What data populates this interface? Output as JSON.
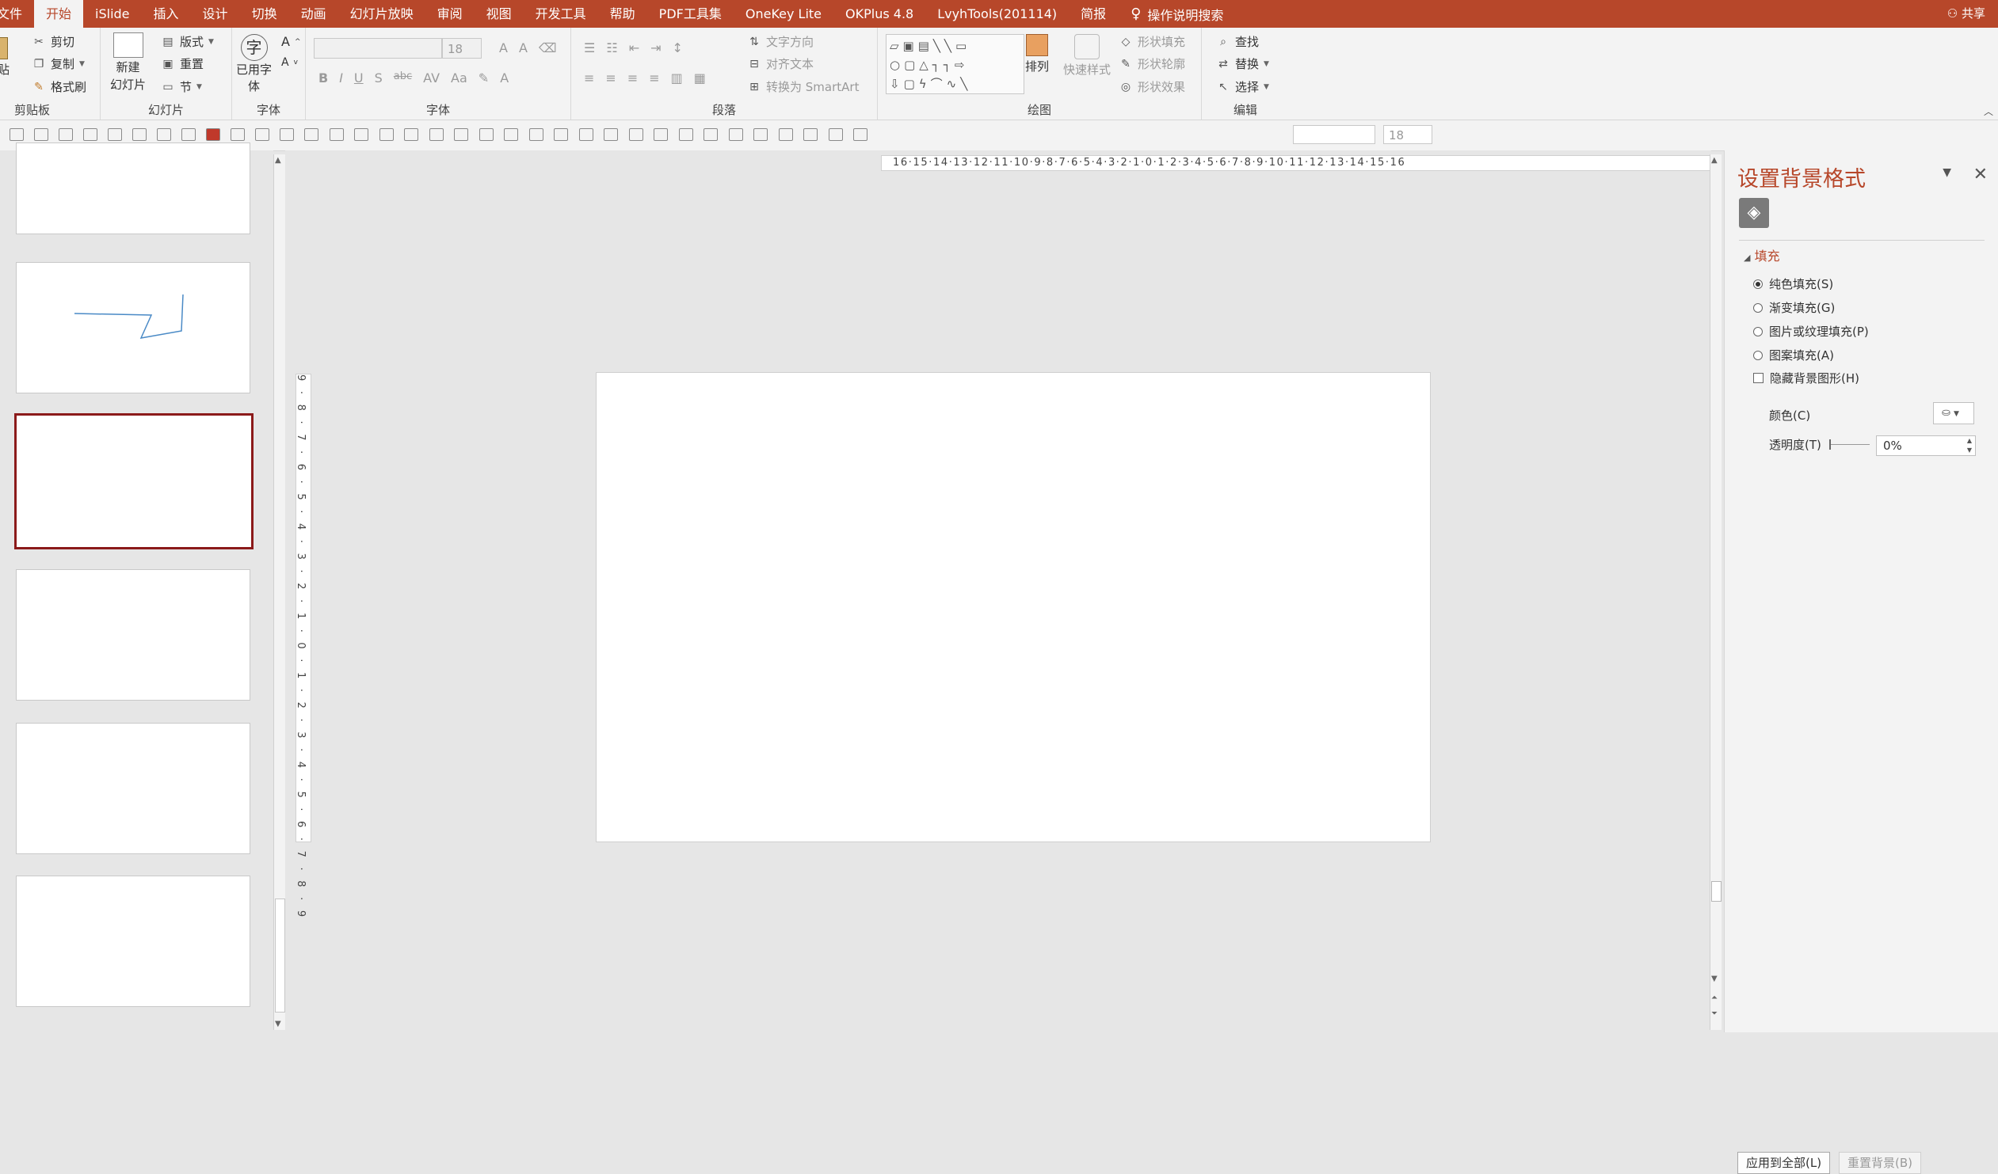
{
  "tabs": [
    "文件",
    "开始",
    "iSlide",
    "插入",
    "设计",
    "切换",
    "动画",
    "幻灯片放映",
    "审阅",
    "视图",
    "开发工具",
    "帮助",
    "PDF工具集",
    "OneKey Lite",
    "OKPlus 4.8",
    "LvyhTools(201114)",
    "简报"
  ],
  "tell_me": "操作说明搜索",
  "share": "共享",
  "ribbon": {
    "clipboard": {
      "paste": "粘贴",
      "cut": "剪切",
      "copy": "复制",
      "format_painter": "格式刷",
      "label": "剪贴板"
    },
    "slides": {
      "new_slide": "新建",
      "new_slide2": "幻灯片",
      "layout": "版式",
      "reset": "重置",
      "section": "节",
      "label": "幻灯片"
    },
    "fontgrp": {
      "used_font": "已用字",
      "used_font2": "体",
      "label": "字体"
    },
    "font": {
      "size": "18",
      "label": "字体"
    },
    "paragraph": {
      "text_dir": "文字方向",
      "align_text": "对齐文本",
      "smartart": "转换为 SmartArt",
      "label": "段落"
    },
    "drawing": {
      "arrange": "排列",
      "quick_styles": "快速样式",
      "shape_fill": "形状填充",
      "shape_outline": "形状轮廓",
      "shape_effects": "形状效果",
      "label": "绘图"
    },
    "editing": {
      "find": "查找",
      "replace": "替换",
      "select": "选择",
      "label": "编辑"
    }
  },
  "qat": {
    "font_size": "18"
  },
  "ruler_numbers": "16·15·14·13·12·11·10·9·8·7·6·5·4·3·2·1·0·1·2·3·4·5·6·7·8·9·10·11·12·13·14·15·16",
  "vruler_numbers": "9·8·7·6·5·4·3·2·1·0·1·2·3·4·5·6·7·8·9",
  "pane": {
    "title": "设置背景格式",
    "section": "填充",
    "options": [
      {
        "label": "纯色填充(S)",
        "selected": true
      },
      {
        "label": "渐变填充(G)",
        "selected": false
      },
      {
        "label": "图片或纹理填充(P)",
        "selected": false
      },
      {
        "label": "图案填充(A)",
        "selected": false
      }
    ],
    "hide_graphics": "隐藏背景图形(H)",
    "color_label": "颜色(C)",
    "transparency_label": "透明度(T)",
    "transparency_value": "0%",
    "apply_all": "应用到全部(L)",
    "reset_bg": "重置背景(B)"
  },
  "colors": {
    "accent": "#b7472a",
    "selected_slide": "#8b1a1a"
  }
}
